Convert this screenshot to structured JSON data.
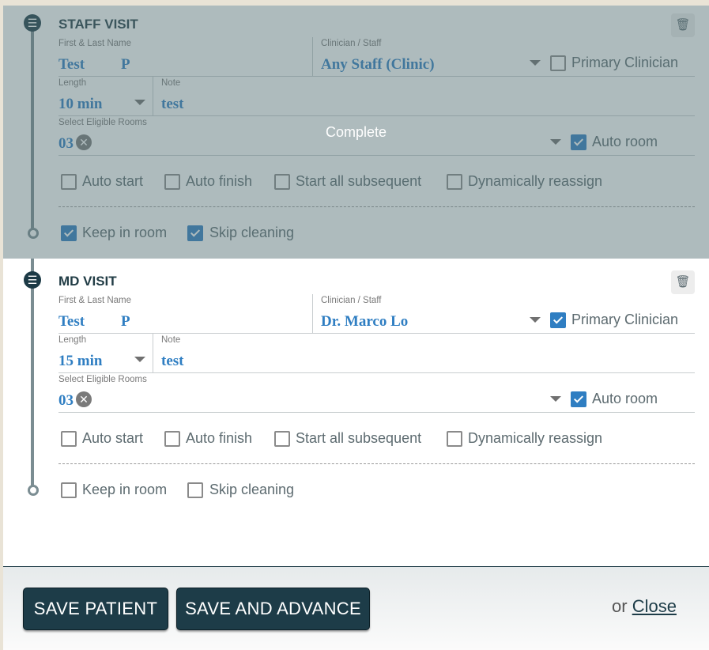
{
  "visits": [
    {
      "title": "STAFF VISIT",
      "status": "Complete",
      "name_label": "First & Last Name",
      "first_name": "Test",
      "last_name": "P",
      "clinician_label": "Clinician / Staff",
      "clinician": "Any Staff (Clinic)",
      "primary_clinician_label": "Primary Clinician",
      "primary_clinician_checked": false,
      "length_label": "Length",
      "length": "10 min",
      "note_label": "Note",
      "note": "test",
      "rooms_label": "Select Eligible Rooms",
      "room": "03",
      "auto_room_label": "Auto room",
      "auto_room_checked": true,
      "options": [
        {
          "label": "Auto start",
          "checked": false
        },
        {
          "label": "Auto finish",
          "checked": false
        },
        {
          "label": "Start all subsequent",
          "checked": false
        },
        {
          "label": "Dynamically reassign",
          "checked": false
        }
      ],
      "keep_in_room_label": "Keep in room",
      "keep_in_room_checked": true,
      "skip_cleaning_label": "Skip cleaning",
      "skip_cleaning_checked": true
    },
    {
      "title": "MD VISIT",
      "name_label": "First & Last Name",
      "first_name": "Test",
      "last_name": "P",
      "clinician_label": "Clinician / Staff",
      "clinician": "Dr. Marco Lo",
      "primary_clinician_label": "Primary Clinician",
      "primary_clinician_checked": true,
      "length_label": "Length",
      "length": "15 min",
      "note_label": "Note",
      "note": "test",
      "rooms_label": "Select Eligible Rooms",
      "room": "03",
      "auto_room_label": "Auto room",
      "auto_room_checked": true,
      "options": [
        {
          "label": "Auto start",
          "checked": false
        },
        {
          "label": "Auto finish",
          "checked": false
        },
        {
          "label": "Start all subsequent",
          "checked": false
        },
        {
          "label": "Dynamically reassign",
          "checked": false
        }
      ],
      "keep_in_room_label": "Keep in room",
      "keep_in_room_checked": false,
      "skip_cleaning_label": "Skip cleaning",
      "skip_cleaning_checked": false
    }
  ],
  "footer": {
    "save_patient": "SAVE PATIENT",
    "save_and_advance": "SAVE AND ADVANCE",
    "or_text": "or",
    "close": "Close"
  },
  "icons": {
    "drag_handle": "drag-handle-icon",
    "trash": "trash-icon",
    "remove_chip": "remove-chip-icon",
    "dropdown": "chevron-down-icon"
  },
  "colors": {
    "accent": "#2f7ec2",
    "dark": "#1d3c48",
    "completed_overlay": "#567076"
  }
}
